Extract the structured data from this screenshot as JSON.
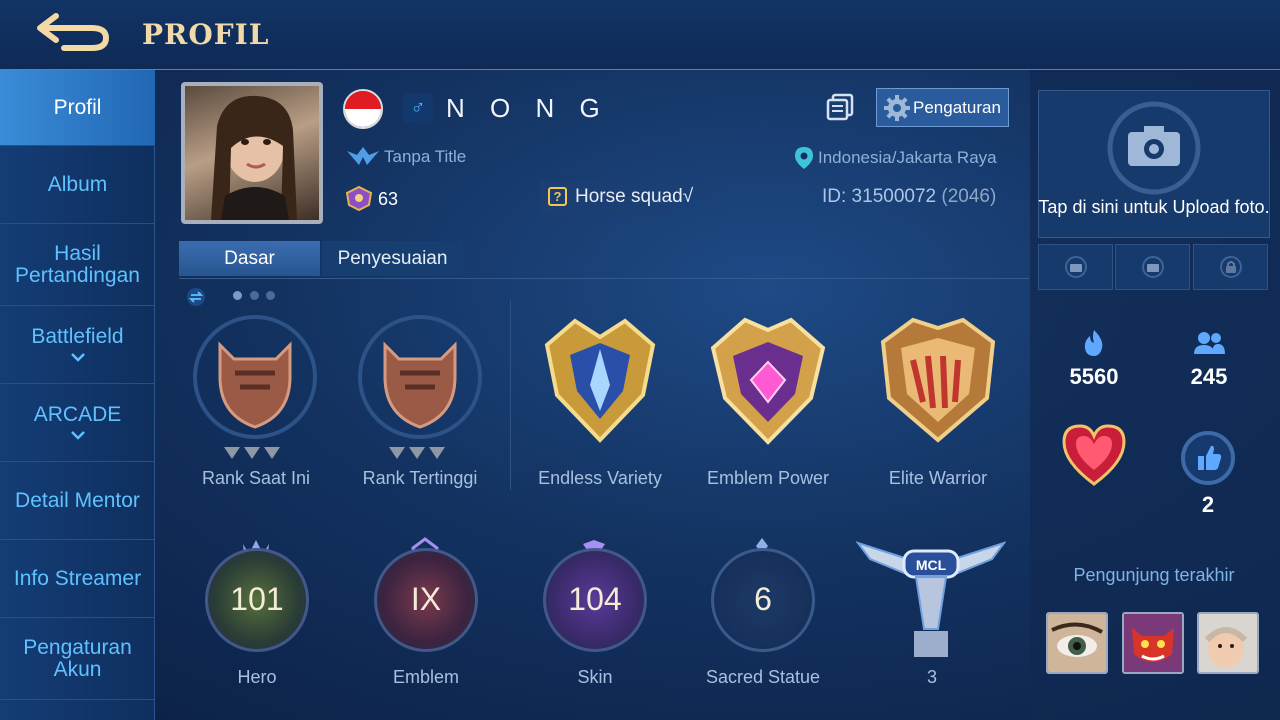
{
  "header": {
    "title": "PROFIL"
  },
  "sidebar": {
    "items": [
      {
        "label": "Profil"
      },
      {
        "label": "Album"
      },
      {
        "label": "Hasil Pertandingan"
      },
      {
        "label": "Battlefield"
      },
      {
        "label": "ARCADE"
      },
      {
        "label": "Detail Mentor"
      },
      {
        "label": "Info Streamer"
      },
      {
        "label": "Pengaturan Akun"
      }
    ]
  },
  "profile": {
    "name": "N O N G",
    "gender_symbol": "♂",
    "title": "Tanpa Title",
    "level": "63",
    "squad": "Horse squad√",
    "location": "Indonesia/Jakarta Raya",
    "id_label": "ID: 31500072",
    "server": "(2046)",
    "settings_label": "Pengaturan"
  },
  "tabs": [
    {
      "label": "Dasar"
    },
    {
      "label": "Penyesuaian"
    }
  ],
  "medals": [
    {
      "label": "Rank Saat Ini"
    },
    {
      "label": "Rank Tertinggi"
    },
    {
      "label": "Endless Variety"
    },
    {
      "label": "Emblem Power"
    },
    {
      "label": "Elite Warrior"
    }
  ],
  "stats": [
    {
      "value": "101",
      "label": "Hero"
    },
    {
      "value": "IX",
      "label": "Emblem"
    },
    {
      "value": "104",
      "label": "Skin"
    },
    {
      "value": "6",
      "label": "Sacred Statue"
    },
    {
      "value": "",
      "label": "3"
    }
  ],
  "right": {
    "upload_text": "Tap di sini untuk Upload foto.",
    "popularity": "5560",
    "followers": "245",
    "likes": "2",
    "visitors_label": "Pengunjung terakhir",
    "mcl_text": "MCL"
  },
  "colors": {
    "accent": "#5fc2ff",
    "title_gold": "#f1d9a8",
    "active_tab": "#3a6db0"
  }
}
